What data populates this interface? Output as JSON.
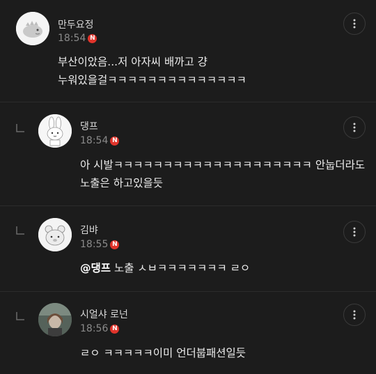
{
  "comments": [
    {
      "author": "만두요정",
      "time": "18:54",
      "badge": "N",
      "lines": [
        "부산이았음...저 아자씨 배까고 걍",
        "누워있을걸ㅋㅋㅋㅋㅋㅋㅋㅋㅋㅋㅋㅋㅋㅋ"
      ],
      "is_reply": false,
      "avatar_icon": "dinosaur-avatar-icon"
    },
    {
      "author": "댕프",
      "time": "18:54",
      "badge": "N",
      "lines": [
        "아 시발ㅋㅋㅋㅋㅋㅋㅋㅋㅋㅋㅋㅋㅋㅋㅋㅋㅋㅋㅋㅋ 안눕더라도",
        "노출은 하고있을듯"
      ],
      "is_reply": true,
      "avatar_icon": "rabbit-avatar-icon"
    },
    {
      "author": "김뱌",
      "time": "18:55",
      "badge": "N",
      "mention": "@댕프",
      "lines": [
        " 노출 ㅅㅂㅋㅋㅋㅋㅋㅋㅋ ㄹㅇ"
      ],
      "is_reply": true,
      "avatar_icon": "bear-avatar-icon"
    },
    {
      "author": "시얼샤 로넌",
      "time": "18:56",
      "badge": "N",
      "lines": [
        "ㄹㅇ ㅋㅋㅋㅋㅋ이미 언더붑패션일듯"
      ],
      "is_reply": true,
      "avatar_icon": "photo-avatar-icon"
    }
  ],
  "icons": {
    "more": "more-vertical-icon",
    "reply": "reply-arrow-icon"
  },
  "colors": {
    "background": "#1c1c1c",
    "badge": "#e0342b",
    "divider": "#2c2c2c"
  }
}
